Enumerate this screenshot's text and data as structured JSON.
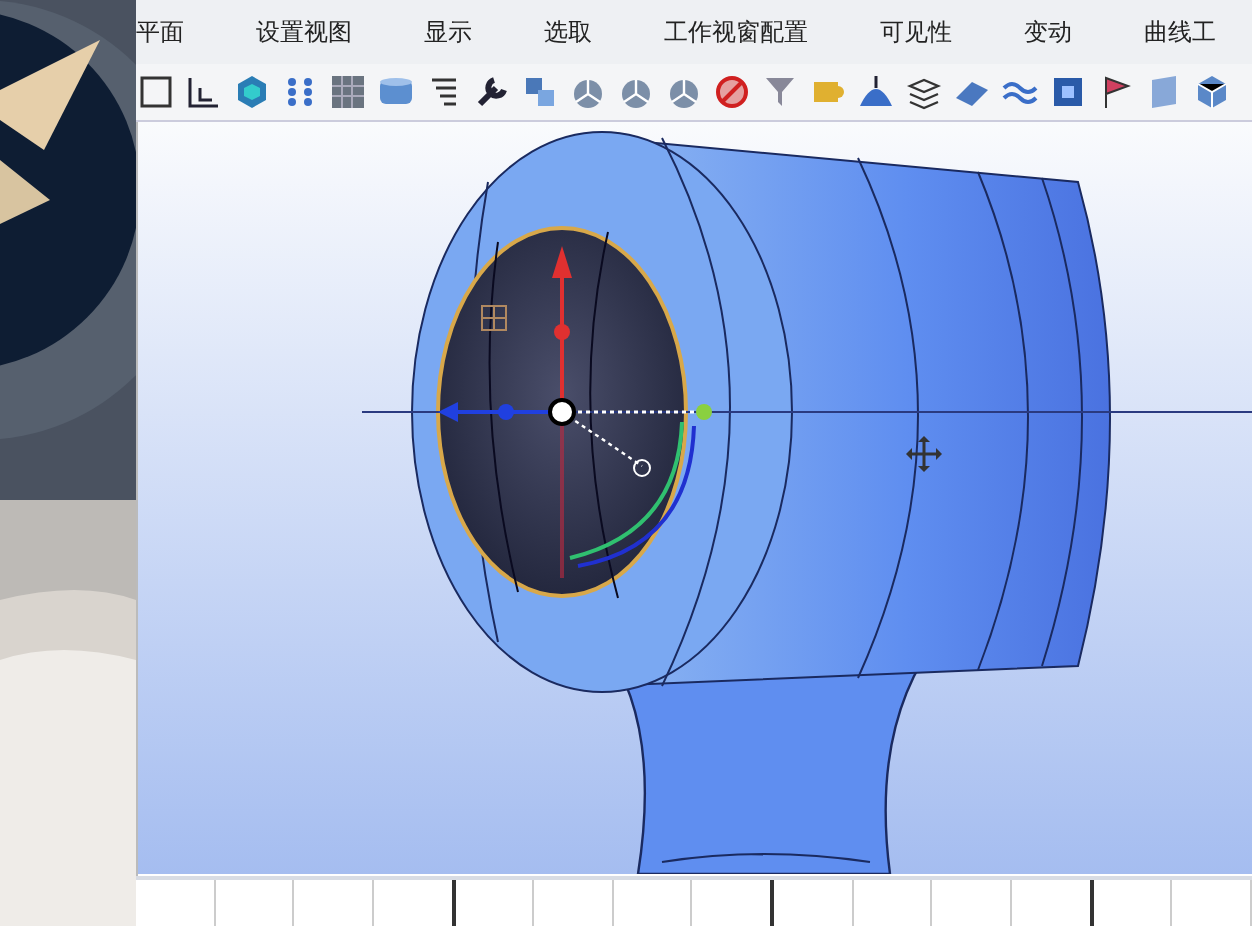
{
  "menu_tabs": [
    {
      "label": "平面",
      "selected": false
    },
    {
      "label": "设置视图",
      "selected": false
    },
    {
      "label": "显示",
      "selected": false
    },
    {
      "label": "选取",
      "selected": false
    },
    {
      "label": "工作视窗配置",
      "selected": false
    },
    {
      "label": "可见性",
      "selected": false
    },
    {
      "label": "变动",
      "selected": false
    },
    {
      "label": "曲线工",
      "selected": false
    }
  ]
}
